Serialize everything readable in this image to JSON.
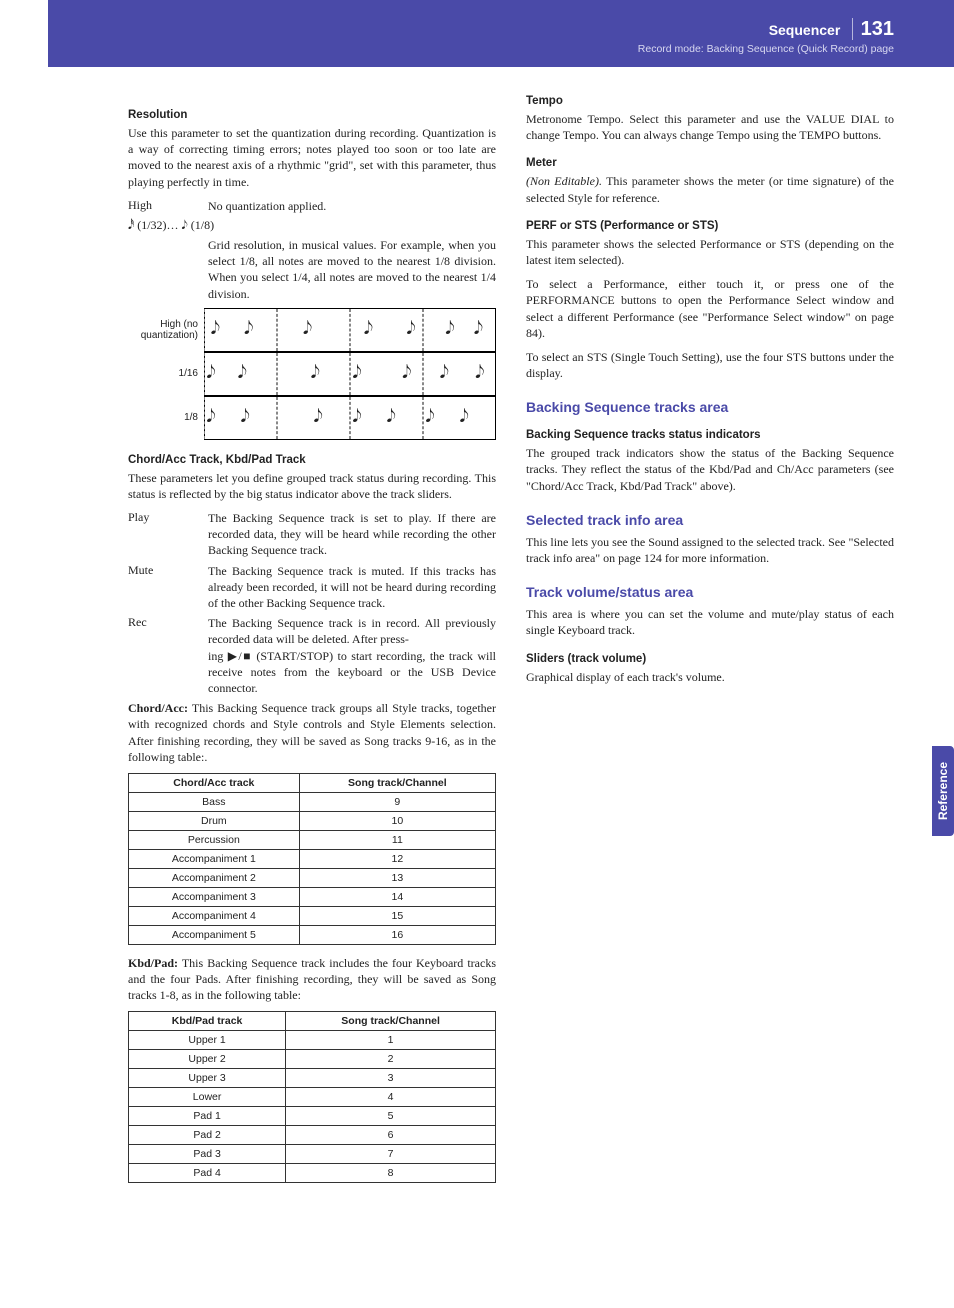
{
  "header": {
    "section": "Sequencer",
    "page_number": "131",
    "subtitle": "Record mode: Backing Sequence (Quick Record) page"
  },
  "side_tab": "Reference",
  "left": {
    "resolution_h": "Resolution",
    "resolution_p": "Use this parameter to set the quantization during recording. Quantization is a way of correcting timing errors; notes played too soon or too late are moved to the nearest axis of a rhythmic \"grid\", set with this parameter, thus playing perfectly in time.",
    "high_term": "High",
    "high_def": "No quantization applied.",
    "range_label": "𝅘𝅥𝅰 (1/32)… 𝅘𝅥𝅮 (1/8)",
    "range_def": "Grid resolution, in musical values. For example, when you select 1/8, all notes are moved to the nearest 1/8 division. When you select 1/4, all notes are moved to the nearest 1/4 division.",
    "q_label_high": "High (no quantization)",
    "q_label_16": "1/16",
    "q_label_8": "1/8",
    "chord_h": "Chord/Acc Track, Kbd/Pad Track",
    "chord_p": "These parameters let you define grouped track status during recording. This status is reflected by the big status indicator above the track sliders.",
    "play_term": "Play",
    "play_def": "The Backing Sequence track is set to play. If there are recorded data, they will be heard while recording the other Backing Sequence track.",
    "mute_term": "Mute",
    "mute_def": "The Backing Sequence track is muted. If this tracks has already been recorded, it will not be heard during recording of the other Backing Sequence track.",
    "rec_term": "Rec",
    "rec_def1": "The Backing Sequence track is in record. All previously recorded data will be deleted. After press-",
    "rec_def2": "ing ▶/■ (START/STOP) to start recording, the track will receive notes from the keyboard or the USB Device connector.",
    "chordacc_p": "Chord/Acc: This Backing Sequence track groups all Style tracks, together with recognized chords and Style controls and Style Elements selection. After finishing recording, they will be saved as Song tracks 9-16, as in the following table:.",
    "chordacc_bold": "Chord/Acc:",
    "table1_h1": "Chord/Acc track",
    "table1_h2": "Song track/Channel",
    "table1_rows": [
      [
        "Bass",
        "9"
      ],
      [
        "Drum",
        "10"
      ],
      [
        "Percussion",
        "11"
      ],
      [
        "Accompaniment 1",
        "12"
      ],
      [
        "Accompaniment 2",
        "13"
      ],
      [
        "Accompaniment 3",
        "14"
      ],
      [
        "Accompaniment 4",
        "15"
      ],
      [
        "Accompaniment 5",
        "16"
      ]
    ]
  },
  "right": {
    "kbdpad_p": "Kbd/Pad: This Backing Sequence track includes the four Keyboard tracks and the four Pads. After finishing recording, they will be saved as Song tracks 1-8, as in the following table:",
    "kbdpad_bold": "Kbd/Pad:",
    "table2_h1": "Kbd/Pad track",
    "table2_h2": "Song track/Channel",
    "table2_rows": [
      [
        "Upper 1",
        "1"
      ],
      [
        "Upper 2",
        "2"
      ],
      [
        "Upper 3",
        "3"
      ],
      [
        "Lower",
        "4"
      ],
      [
        "Pad 1",
        "5"
      ],
      [
        "Pad 2",
        "6"
      ],
      [
        "Pad 3",
        "7"
      ],
      [
        "Pad 4",
        "8"
      ]
    ],
    "tempo_h": "Tempo",
    "tempo_p": "Metronome Tempo. Select this parameter and use the VALUE DIAL to change Tempo. You can always change Tempo using the TEMPO buttons.",
    "meter_h": "Meter",
    "meter_p": "(Non Editable). This parameter shows the meter (or time signature) of the selected Style for reference.",
    "meter_italic": "(Non Editable).",
    "perf_h": "PERF or STS (Performance or STS)",
    "perf_p1": "This parameter shows the selected Performance or STS (depending on the latest item selected).",
    "perf_p2": "To select a Performance, either touch it, or press one of the PERFORMANCE buttons to open the Performance Select window and select a different Performance (see \"Performance Select window\" on page 84).",
    "perf_p3": "To select an STS (Single Touch Setting), use the four STS buttons under the display.",
    "backseq_h": "Backing Sequence tracks area",
    "backseq_sub": "Backing Sequence tracks status indicators",
    "backseq_p": "The grouped track indicators show the status of the Backing Sequence tracks. They reflect the status of the Kbd/Pad and Ch/Acc parameters (see \"Chord/Acc Track, Kbd/Pad Track\" above).",
    "selected_h": "Selected track info area",
    "selected_p": "This line lets you see the Sound assigned to the selected track. See \"Selected track info area\" on page 124 for more information.",
    "volume_h": "Track volume/status area",
    "volume_p": "This area is where you can set the volume and mute/play status of each single Keyboard track.",
    "sliders_h": "Sliders (track volume)",
    "sliders_p": "Graphical display of each track's volume."
  }
}
